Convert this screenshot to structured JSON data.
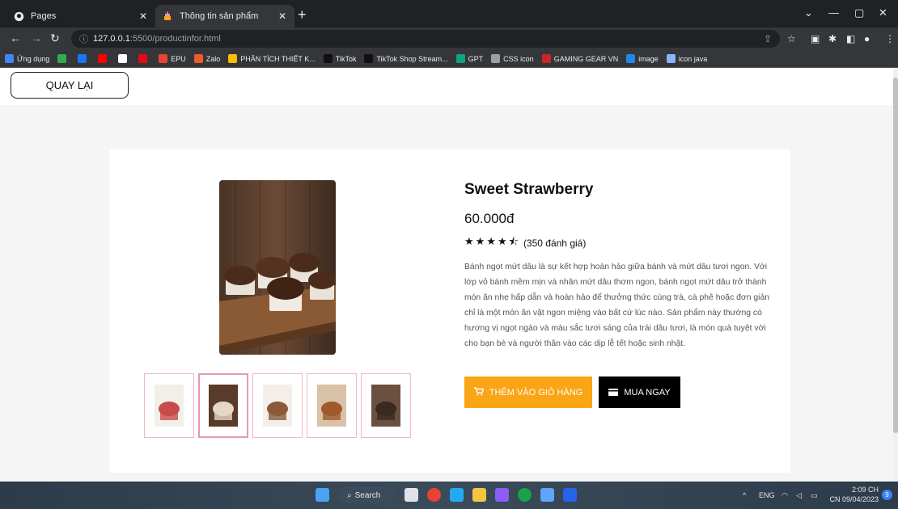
{
  "browser": {
    "tabs": [
      {
        "title": "Pages",
        "icon": "github-icon"
      },
      {
        "title": "Thông tin sản phẩm",
        "icon": "cake-icon"
      }
    ],
    "url_host": "127.0.0.1",
    "url_path": ":5500/productinfor.html",
    "bookmarks": [
      {
        "label": "Ứng dụng",
        "color": "#4285f4"
      },
      {
        "label": "",
        "color": "#34a853"
      },
      {
        "label": "",
        "color": "#1877f2"
      },
      {
        "label": "",
        "color": "#ff0000"
      },
      {
        "label": "",
        "color": "#ffffff"
      },
      {
        "label": "",
        "color": "#e50914"
      },
      {
        "label": "EPU",
        "color": "#ea4335"
      },
      {
        "label": "Zalo",
        "color": "#e95d2d"
      },
      {
        "label": "PHÂN TÍCH THIẾT K...",
        "color": "#fbbc04"
      },
      {
        "label": "TikTok",
        "color": "#111111"
      },
      {
        "label": "TikTok Shop Stream...",
        "color": "#111111"
      },
      {
        "label": "GPT",
        "color": "#10a37f"
      },
      {
        "label": "CSS icon",
        "color": "#9aa0a6"
      },
      {
        "label": "GAMING GEAR VN",
        "color": "#c62828"
      },
      {
        "label": "image",
        "color": "#1e88e5"
      },
      {
        "label": "icon java",
        "color": "#8ab4f8"
      }
    ]
  },
  "page": {
    "back_label": "QUAY LẠI",
    "product": {
      "name": "Sweet Strawberry",
      "price": "60.000đ",
      "stars": "★★★★⯪",
      "rating_value": 4.5,
      "reviews": "(350 đánh giá)",
      "description": "Bánh ngọt mứt dâu là sự kết hợp hoàn hảo giữa bánh và mứt dâu tươi ngon. Với lớp vỏ bánh mềm mịn và nhân mứt dâu thơm ngon, bánh ngọt mứt dâu trở thành món ăn nhẹ hấp dẫn và hoàn hảo để thưởng thức cùng trà, cà phê hoặc đơn giản chỉ là một món ăn vặt ngon miệng vào bất cứ lúc nào. Sản phẩm này thường có hương vị ngọt ngào và màu sắc tươi sáng của trái dâu tươi, là món quà tuyệt vời cho bạn bè và người thân vào các dịp lễ tết hoặc sinh nhật.",
      "add_to_cart": "THÊM VÀO GIỎ HÀNG",
      "buy_now": "MUA NGAY"
    },
    "thumbnails": [
      {
        "name": "strawberry-cake-thumb"
      },
      {
        "name": "muffin-board-thumb",
        "selected": true
      },
      {
        "name": "chocolate-muffin-thumb"
      },
      {
        "name": "cookie-plate-thumb"
      },
      {
        "name": "brownie-cup-thumb"
      }
    ],
    "colors": {
      "cart_button": "#f9a516",
      "buy_button": "#000000",
      "thumb_border": "#f4b6c2"
    }
  },
  "taskbar": {
    "search": "Search",
    "lang": "ENG",
    "time": "2:09 CH",
    "date": "CN 09/04/2023",
    "notifications": "9"
  }
}
